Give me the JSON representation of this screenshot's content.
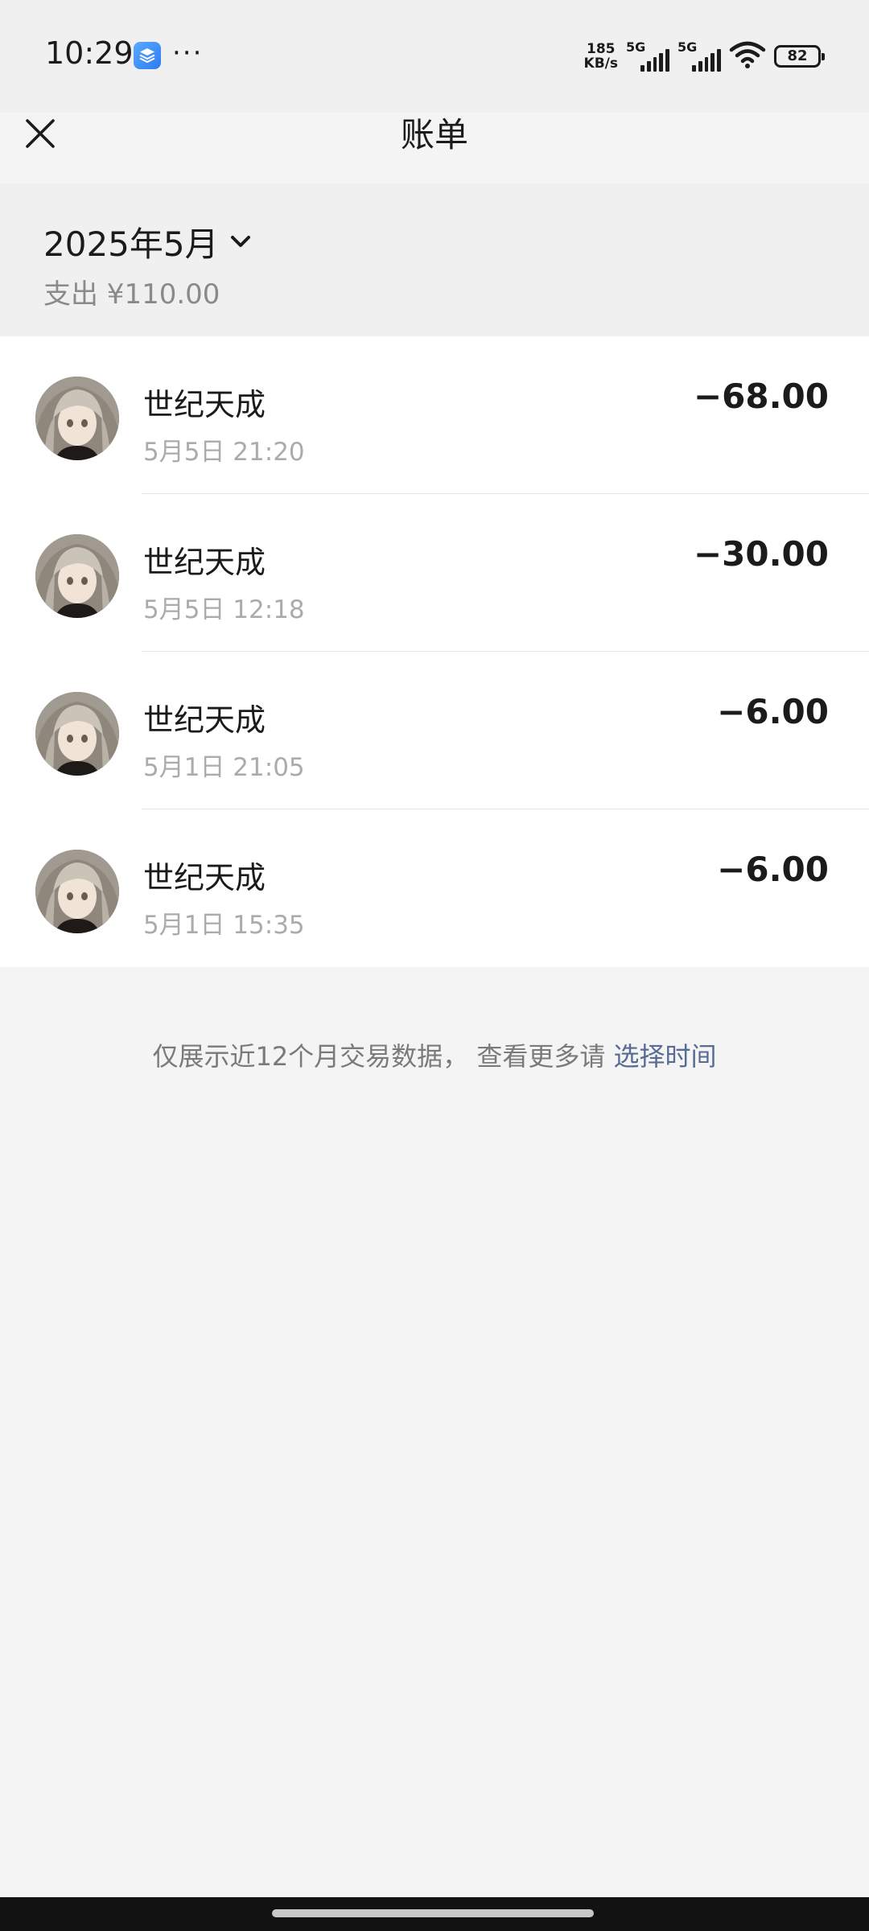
{
  "status_bar": {
    "time": "10:29",
    "app_icon": "layers-app-icon",
    "more": "···",
    "net_speed_value": "185",
    "net_speed_unit": "KB/s",
    "signal1_label": "5G",
    "signal2_label": "5G",
    "battery": "82"
  },
  "nav": {
    "title": "账单",
    "close_icon": "close-icon"
  },
  "month": {
    "label": "2025年5月",
    "summary": "支出 ¥110.00"
  },
  "transactions": [
    {
      "name": "世纪天成",
      "time": "5月5日 21:20",
      "amount": "−68.00"
    },
    {
      "name": "世纪天成",
      "time": "5月5日 12:18",
      "amount": "−30.00"
    },
    {
      "name": "世纪天成",
      "time": "5月1日 21:05",
      "amount": "−6.00"
    },
    {
      "name": "世纪天成",
      "time": "5月1日 15:35",
      "amount": "−6.00"
    }
  ],
  "footer": {
    "note": "仅展示近12个月交易数据，  查看更多请",
    "link": "选择时间"
  },
  "colors": {
    "link": "#576b95",
    "page_bg": "#f4f4f4",
    "header_bg": "#f0f0f0"
  }
}
